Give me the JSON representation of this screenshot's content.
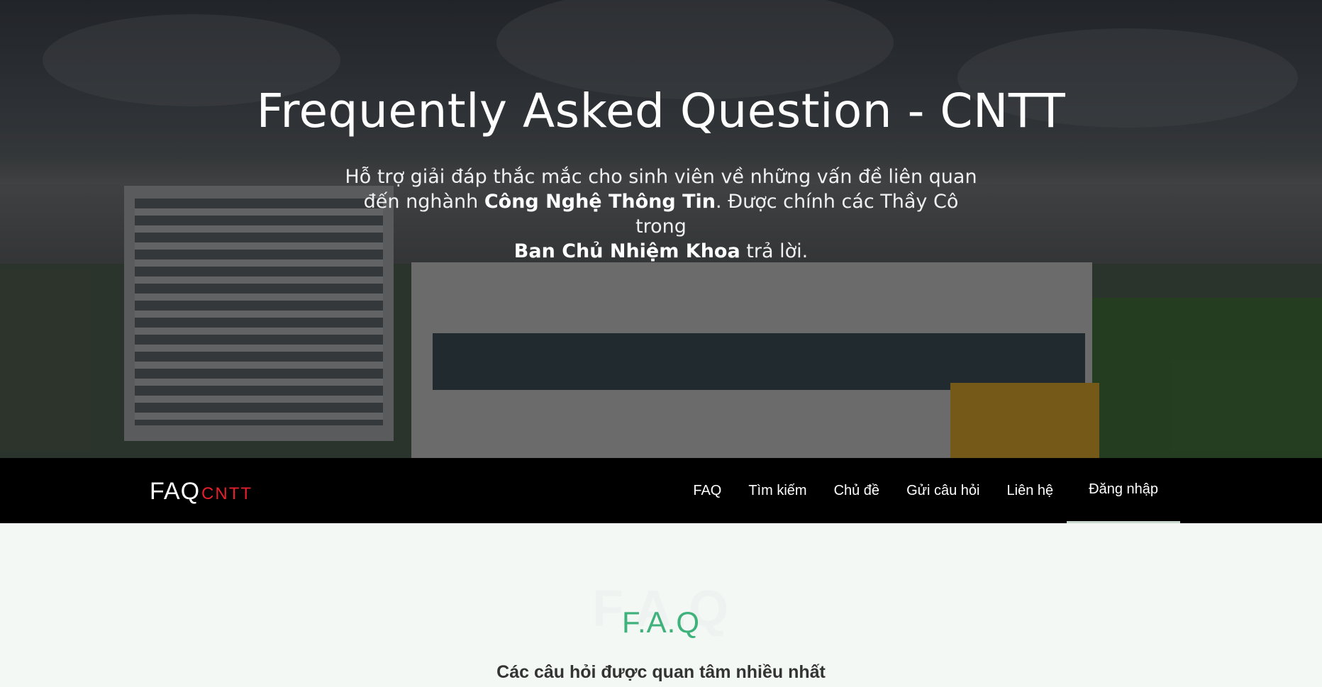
{
  "hero": {
    "title": "Frequently Asked Question - CNTT",
    "sub_line1": "Hỗ trợ giải đáp thắc mắc cho sinh viên về những vấn đề liên quan",
    "sub_line2_pre": "đến nghành ",
    "sub_line2_bold": "Công Nghệ Thông Tin",
    "sub_line2_post": ". Được chính các Thầy Cô trong",
    "sub_line3_bold": "Ban Chủ Nhiệm Khoa",
    "sub_line3_post": " trả lời."
  },
  "brand": {
    "main": "FAQ",
    "accent": "CNTT"
  },
  "nav": {
    "items": [
      "FAQ",
      "Tìm kiếm",
      "Chủ đề",
      "Gửi câu hỏi",
      "Liên hệ",
      "Đăng nhập"
    ],
    "active": "Đăng nhập"
  },
  "section": {
    "ghost": "F.A.Q",
    "heading": "F.A.Q",
    "description": "Các câu hỏi được quan tâm nhiều nhất"
  },
  "colors": {
    "nav_bg": "#000000",
    "accent_red": "#e5202a",
    "heading_green": "#3fb17a",
    "section_bg": "#f3f8f5"
  }
}
